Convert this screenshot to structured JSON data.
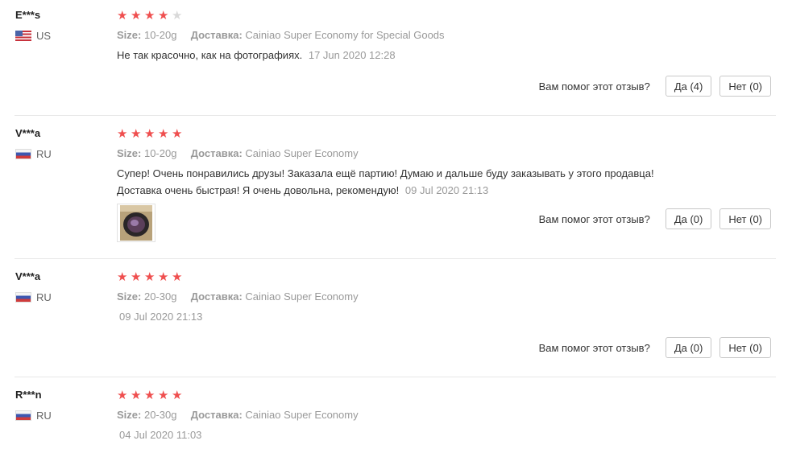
{
  "labels": {
    "size": "Size:",
    "delivery": "Доставка:",
    "helpful_question": "Вам помог этот отзыв?"
  },
  "reviews": [
    {
      "user": "E***s",
      "country": "US",
      "rating": 4,
      "size": "10-20g",
      "delivery": "Cainiao Super Economy for Special Goods",
      "text": "Не так красочно, как на фотографиях.",
      "date": "17 Jun 2020 12:28",
      "yes": "Да (4)",
      "no": "Нет (0)"
    },
    {
      "user": "V***a",
      "country": "RU",
      "rating": 5,
      "size": "10-20g",
      "delivery": "Cainiao Super Economy",
      "text_line1": "Супер! Очень понравились друзы! Заказала ещё партию! Думаю и дальше буду заказывать у этого продавца!",
      "text_line2": "Доставка очень быстрая! Я очень довольна, рекомендую!",
      "date": "09 Jul 2020 21:13",
      "yes": "Да (0)",
      "no": "Нет (0)"
    },
    {
      "user": "V***a",
      "country": "RU",
      "rating": 5,
      "size": "20-30g",
      "delivery": "Cainiao Super Economy",
      "date": "09 Jul 2020 21:13",
      "yes": "Да (0)",
      "no": "Нет (0)"
    },
    {
      "user": "R***n",
      "country": "RU",
      "rating": 5,
      "size": "20-30g",
      "delivery": "Cainiao Super Economy",
      "date": "04 Jul 2020 11:03"
    }
  ],
  "colors": {
    "star_on": "#ef4f4f",
    "star_off": "#d9d9d9"
  }
}
